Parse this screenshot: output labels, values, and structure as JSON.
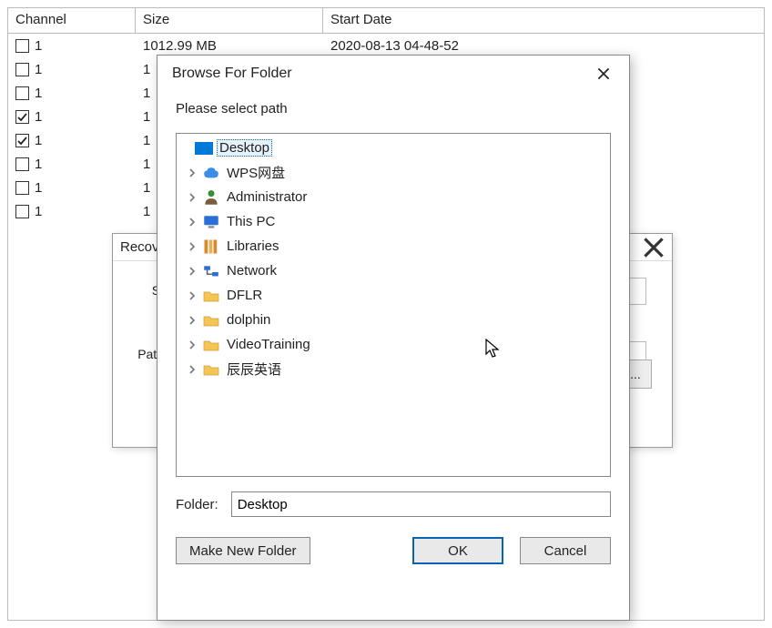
{
  "table": {
    "headers": {
      "channel": "Channel",
      "size": "Size",
      "start_date": "Start Date"
    },
    "rows": [
      {
        "checked": false,
        "channel": "1",
        "size": "1012.99 MB",
        "date": "2020-08-13 04-48-52"
      },
      {
        "checked": false,
        "channel": "1",
        "size": "1",
        "date": ""
      },
      {
        "checked": false,
        "channel": "1",
        "size": "1",
        "date": ""
      },
      {
        "checked": true,
        "channel": "1",
        "size": "1",
        "date": ""
      },
      {
        "checked": true,
        "channel": "1",
        "size": "1",
        "date": ""
      },
      {
        "checked": false,
        "channel": "1",
        "size": "1",
        "date": ""
      },
      {
        "checked": false,
        "channel": "1",
        "size": "1",
        "date": ""
      },
      {
        "checked": false,
        "channel": "1",
        "size": "1",
        "date": ""
      }
    ]
  },
  "recov": {
    "title": "Recov",
    "start_label": "St",
    "path_label": "Path",
    "browse_label": "..."
  },
  "bff": {
    "title": "Browse For Folder",
    "instruction": "Please select path",
    "folder_label": "Folder:",
    "folder_value": "Desktop",
    "buttons": {
      "make_new": "Make New Folder",
      "ok": "OK",
      "cancel": "Cancel"
    },
    "tree": [
      {
        "label": "Desktop",
        "icon": "desktop",
        "depth": 0,
        "expandable": false,
        "selected": true
      },
      {
        "label": "WPS网盘",
        "icon": "cloud",
        "depth": 1,
        "expandable": true,
        "selected": false
      },
      {
        "label": "Administrator",
        "icon": "user",
        "depth": 1,
        "expandable": true,
        "selected": false
      },
      {
        "label": "This PC",
        "icon": "pc",
        "depth": 1,
        "expandable": true,
        "selected": false
      },
      {
        "label": "Libraries",
        "icon": "lib",
        "depth": 1,
        "expandable": true,
        "selected": false
      },
      {
        "label": "Network",
        "icon": "net",
        "depth": 1,
        "expandable": true,
        "selected": false
      },
      {
        "label": "DFLR",
        "icon": "folder",
        "depth": 1,
        "expandable": true,
        "selected": false
      },
      {
        "label": "dolphin",
        "icon": "folder",
        "depth": 1,
        "expandable": true,
        "selected": false
      },
      {
        "label": "VideoTraining",
        "icon": "folder",
        "depth": 1,
        "expandable": true,
        "selected": false
      },
      {
        "label": "辰辰英语",
        "icon": "folder",
        "depth": 1,
        "expandable": true,
        "selected": false
      }
    ]
  }
}
